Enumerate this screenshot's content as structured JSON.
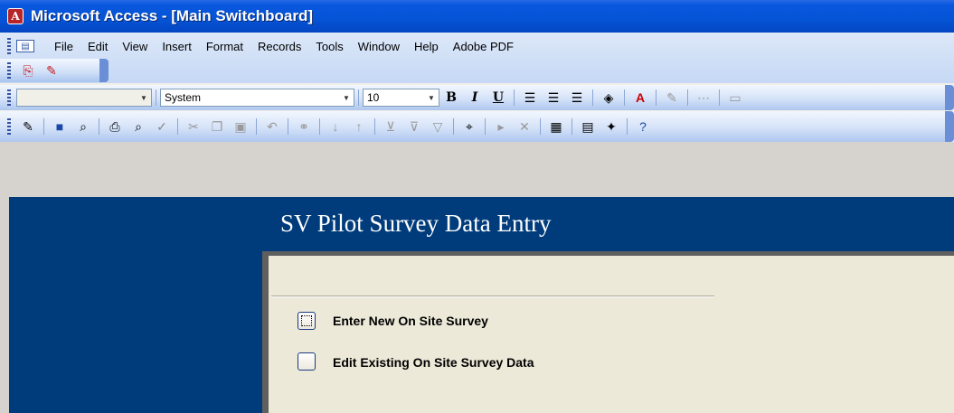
{
  "window": {
    "title": "Microsoft Access - [Main Switchboard]"
  },
  "menu": {
    "items": [
      "File",
      "Edit",
      "View",
      "Insert",
      "Format",
      "Records",
      "Tools",
      "Window",
      "Help",
      "Adobe PDF"
    ]
  },
  "format_toolbar": {
    "object_combo_value": "",
    "font_value": "System",
    "size_value": "10",
    "bold": "B",
    "italic": "I",
    "underline": "U"
  },
  "colors": {
    "titlebar": "#0554d6",
    "form_header": "#003b7b",
    "form_body": "#ece9d8"
  },
  "form": {
    "title": "SV Pilot Survey Data Entry",
    "buttons": [
      {
        "label": "Enter New On Site Survey"
      },
      {
        "label": "Edit Existing On Site Survey Data"
      }
    ]
  }
}
